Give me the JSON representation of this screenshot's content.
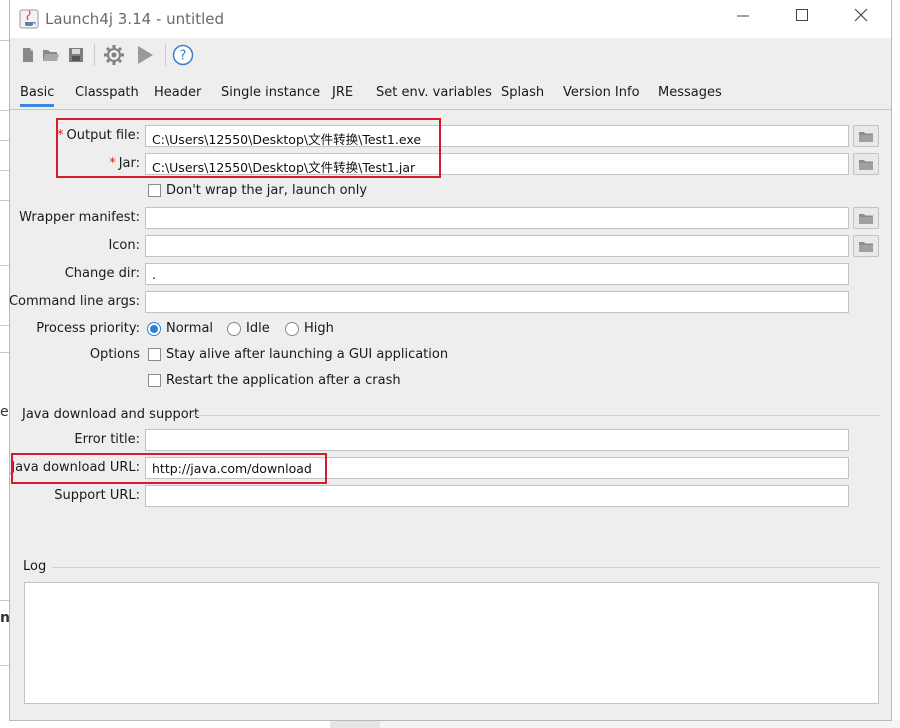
{
  "window": {
    "title": "Launch4j 3.14 - untitled"
  },
  "toolbar": {
    "icons": [
      "new-icon",
      "open-icon",
      "save-icon",
      "settings-icon",
      "run-icon",
      "help-icon"
    ],
    "help_glyph": "?"
  },
  "tabs": [
    {
      "label": "Basic",
      "active": true
    },
    {
      "label": "Classpath"
    },
    {
      "label": "Header"
    },
    {
      "label": "Single instance"
    },
    {
      "label": "JRE"
    },
    {
      "label": "Set env. variables"
    },
    {
      "label": "Splash"
    },
    {
      "label": "Version Info"
    },
    {
      "label": "Messages"
    }
  ],
  "basic": {
    "required_mark": "*",
    "output_file_label": "Output file:",
    "output_file_value": "C:\\Users\\12550\\Desktop\\文件转换\\Test1.exe",
    "jar_label": "Jar:",
    "jar_value": "C:\\Users\\12550\\Desktop\\文件转换\\Test1.jar",
    "dont_wrap_label": "Don't wrap the jar, launch only",
    "wrapper_manifest_label": "Wrapper manifest:",
    "wrapper_manifest_value": "",
    "icon_label": "Icon:",
    "icon_value": "",
    "change_dir_label": "Change dir:",
    "change_dir_value": ".",
    "cmd_args_label": "Command line args:",
    "cmd_args_value": "",
    "priority_label": "Process priority:",
    "priority_options": [
      "Normal",
      "Idle",
      "High"
    ],
    "priority_selected": "Normal",
    "options_label": "Options",
    "stay_alive_label": "Stay alive after launching a GUI application",
    "restart_label": "Restart the application after a crash"
  },
  "java_download": {
    "section_title": "Java download and support",
    "error_title_label": "Error title:",
    "error_title_value": "",
    "download_url_label": "Java download URL:",
    "download_url_value": "http://java.com/download",
    "support_url_label": "Support URL:",
    "support_url_value": ""
  },
  "log": {
    "section_title": "Log",
    "content": ""
  },
  "backdrop": {
    "glyph_1": "e",
    "glyph_2": "n"
  },
  "colors": {
    "accent": "#3b86e0",
    "required": "#d9230f",
    "annotation": "#d81b2a"
  }
}
